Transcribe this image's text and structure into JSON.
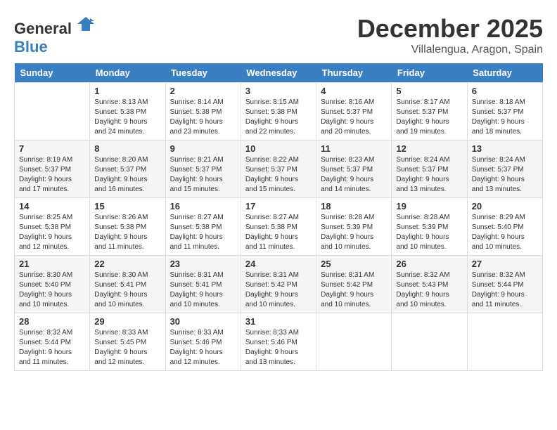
{
  "logo": {
    "general": "General",
    "blue": "Blue"
  },
  "title": {
    "month": "December 2025",
    "location": "Villalengua, Aragon, Spain"
  },
  "header_days": [
    "Sunday",
    "Monday",
    "Tuesday",
    "Wednesday",
    "Thursday",
    "Friday",
    "Saturday"
  ],
  "weeks": [
    [
      {
        "day": "",
        "sunrise": "",
        "sunset": "",
        "daylight": ""
      },
      {
        "day": "1",
        "sunrise": "Sunrise: 8:13 AM",
        "sunset": "Sunset: 5:38 PM",
        "daylight": "Daylight: 9 hours and 24 minutes."
      },
      {
        "day": "2",
        "sunrise": "Sunrise: 8:14 AM",
        "sunset": "Sunset: 5:38 PM",
        "daylight": "Daylight: 9 hours and 23 minutes."
      },
      {
        "day": "3",
        "sunrise": "Sunrise: 8:15 AM",
        "sunset": "Sunset: 5:38 PM",
        "daylight": "Daylight: 9 hours and 22 minutes."
      },
      {
        "day": "4",
        "sunrise": "Sunrise: 8:16 AM",
        "sunset": "Sunset: 5:37 PM",
        "daylight": "Daylight: 9 hours and 20 minutes."
      },
      {
        "day": "5",
        "sunrise": "Sunrise: 8:17 AM",
        "sunset": "Sunset: 5:37 PM",
        "daylight": "Daylight: 9 hours and 19 minutes."
      },
      {
        "day": "6",
        "sunrise": "Sunrise: 8:18 AM",
        "sunset": "Sunset: 5:37 PM",
        "daylight": "Daylight: 9 hours and 18 minutes."
      }
    ],
    [
      {
        "day": "7",
        "sunrise": "Sunrise: 8:19 AM",
        "sunset": "Sunset: 5:37 PM",
        "daylight": "Daylight: 9 hours and 17 minutes."
      },
      {
        "day": "8",
        "sunrise": "Sunrise: 8:20 AM",
        "sunset": "Sunset: 5:37 PM",
        "daylight": "Daylight: 9 hours and 16 minutes."
      },
      {
        "day": "9",
        "sunrise": "Sunrise: 8:21 AM",
        "sunset": "Sunset: 5:37 PM",
        "daylight": "Daylight: 9 hours and 15 minutes."
      },
      {
        "day": "10",
        "sunrise": "Sunrise: 8:22 AM",
        "sunset": "Sunset: 5:37 PM",
        "daylight": "Daylight: 9 hours and 15 minutes."
      },
      {
        "day": "11",
        "sunrise": "Sunrise: 8:23 AM",
        "sunset": "Sunset: 5:37 PM",
        "daylight": "Daylight: 9 hours and 14 minutes."
      },
      {
        "day": "12",
        "sunrise": "Sunrise: 8:24 AM",
        "sunset": "Sunset: 5:37 PM",
        "daylight": "Daylight: 9 hours and 13 minutes."
      },
      {
        "day": "13",
        "sunrise": "Sunrise: 8:24 AM",
        "sunset": "Sunset: 5:37 PM",
        "daylight": "Daylight: 9 hours and 13 minutes."
      }
    ],
    [
      {
        "day": "14",
        "sunrise": "Sunrise: 8:25 AM",
        "sunset": "Sunset: 5:38 PM",
        "daylight": "Daylight: 9 hours and 12 minutes."
      },
      {
        "day": "15",
        "sunrise": "Sunrise: 8:26 AM",
        "sunset": "Sunset: 5:38 PM",
        "daylight": "Daylight: 9 hours and 11 minutes."
      },
      {
        "day": "16",
        "sunrise": "Sunrise: 8:27 AM",
        "sunset": "Sunset: 5:38 PM",
        "daylight": "Daylight: 9 hours and 11 minutes."
      },
      {
        "day": "17",
        "sunrise": "Sunrise: 8:27 AM",
        "sunset": "Sunset: 5:38 PM",
        "daylight": "Daylight: 9 hours and 11 minutes."
      },
      {
        "day": "18",
        "sunrise": "Sunrise: 8:28 AM",
        "sunset": "Sunset: 5:39 PM",
        "daylight": "Daylight: 9 hours and 10 minutes."
      },
      {
        "day": "19",
        "sunrise": "Sunrise: 8:28 AM",
        "sunset": "Sunset: 5:39 PM",
        "daylight": "Daylight: 9 hours and 10 minutes."
      },
      {
        "day": "20",
        "sunrise": "Sunrise: 8:29 AM",
        "sunset": "Sunset: 5:40 PM",
        "daylight": "Daylight: 9 hours and 10 minutes."
      }
    ],
    [
      {
        "day": "21",
        "sunrise": "Sunrise: 8:30 AM",
        "sunset": "Sunset: 5:40 PM",
        "daylight": "Daylight: 9 hours and 10 minutes."
      },
      {
        "day": "22",
        "sunrise": "Sunrise: 8:30 AM",
        "sunset": "Sunset: 5:41 PM",
        "daylight": "Daylight: 9 hours and 10 minutes."
      },
      {
        "day": "23",
        "sunrise": "Sunrise: 8:31 AM",
        "sunset": "Sunset: 5:41 PM",
        "daylight": "Daylight: 9 hours and 10 minutes."
      },
      {
        "day": "24",
        "sunrise": "Sunrise: 8:31 AM",
        "sunset": "Sunset: 5:42 PM",
        "daylight": "Daylight: 9 hours and 10 minutes."
      },
      {
        "day": "25",
        "sunrise": "Sunrise: 8:31 AM",
        "sunset": "Sunset: 5:42 PM",
        "daylight": "Daylight: 9 hours and 10 minutes."
      },
      {
        "day": "26",
        "sunrise": "Sunrise: 8:32 AM",
        "sunset": "Sunset: 5:43 PM",
        "daylight": "Daylight: 9 hours and 10 minutes."
      },
      {
        "day": "27",
        "sunrise": "Sunrise: 8:32 AM",
        "sunset": "Sunset: 5:44 PM",
        "daylight": "Daylight: 9 hours and 11 minutes."
      }
    ],
    [
      {
        "day": "28",
        "sunrise": "Sunrise: 8:32 AM",
        "sunset": "Sunset: 5:44 PM",
        "daylight": "Daylight: 9 hours and 11 minutes."
      },
      {
        "day": "29",
        "sunrise": "Sunrise: 8:33 AM",
        "sunset": "Sunset: 5:45 PM",
        "daylight": "Daylight: 9 hours and 12 minutes."
      },
      {
        "day": "30",
        "sunrise": "Sunrise: 8:33 AM",
        "sunset": "Sunset: 5:46 PM",
        "daylight": "Daylight: 9 hours and 12 minutes."
      },
      {
        "day": "31",
        "sunrise": "Sunrise: 8:33 AM",
        "sunset": "Sunset: 5:46 PM",
        "daylight": "Daylight: 9 hours and 13 minutes."
      },
      {
        "day": "",
        "sunrise": "",
        "sunset": "",
        "daylight": ""
      },
      {
        "day": "",
        "sunrise": "",
        "sunset": "",
        "daylight": ""
      },
      {
        "day": "",
        "sunrise": "",
        "sunset": "",
        "daylight": ""
      }
    ]
  ]
}
